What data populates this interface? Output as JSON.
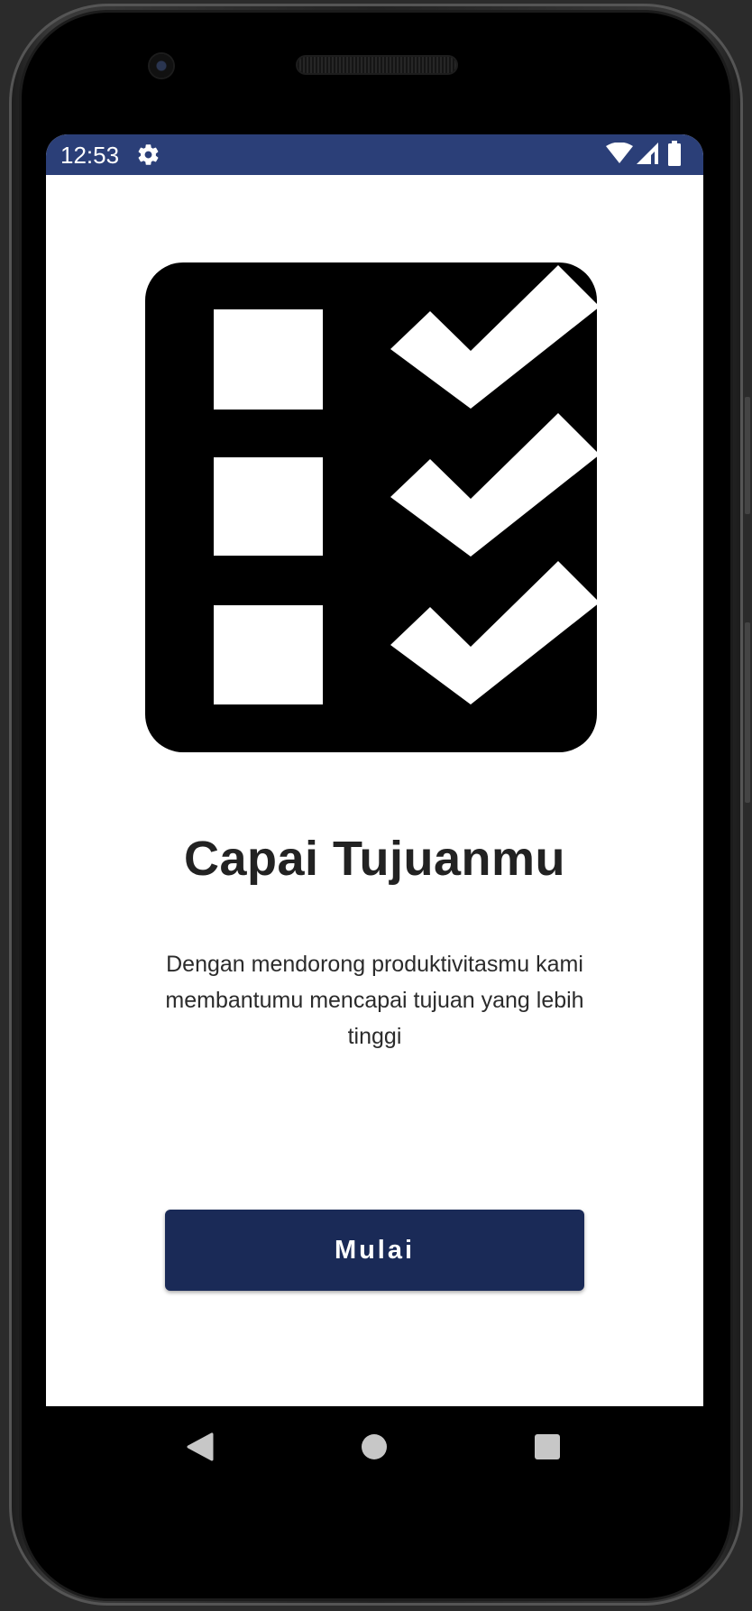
{
  "status_bar": {
    "time": "12:53",
    "background_color": "#2b3f78",
    "icons": [
      "gear-icon",
      "wifi-icon",
      "signal-icon",
      "battery-icon"
    ]
  },
  "onboarding": {
    "illustration_icon": "checklist-icon",
    "title": "Capai Tujuanmu",
    "description": "Dengan mendorong produktivitasmu kami membantumu mencapai tujuan yang lebih tinggi",
    "start_button_label": "Mulai",
    "accent_color": "#1a2a57"
  },
  "navigation_bar": {
    "icons": [
      "back-icon",
      "home-icon",
      "recents-icon"
    ]
  }
}
